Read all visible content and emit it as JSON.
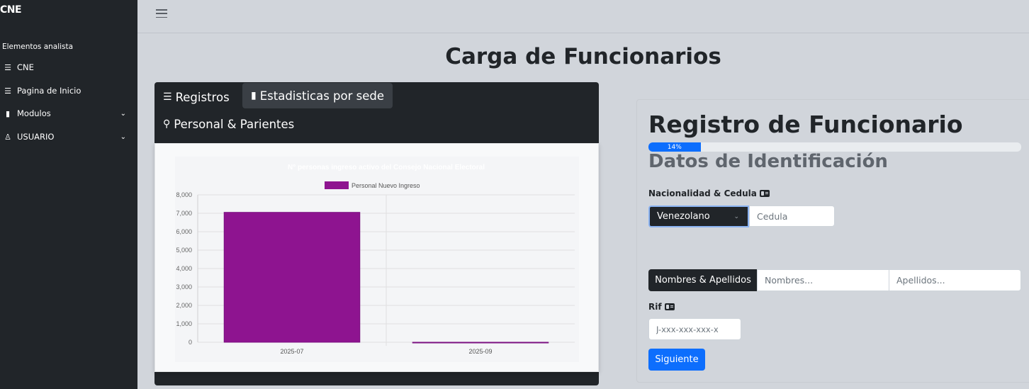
{
  "sidebar": {
    "brand": "CNE",
    "section_heading": "Elementos analista",
    "items": [
      {
        "label": "CNE",
        "icon": "list-icon"
      },
      {
        "label": "Pagina de Inicio",
        "icon": "list-icon"
      },
      {
        "label": "Modulos",
        "icon": "file-icon",
        "has_submenu": true
      },
      {
        "label": "USUARIO",
        "icon": "user-icon",
        "has_submenu": true
      }
    ]
  },
  "page": {
    "title": "Carga de Funcionarios"
  },
  "tabs": {
    "registros": "Registros",
    "estadisticas": "Estadisticas por sede",
    "personal": "Personal & Parientes"
  },
  "chart_data": {
    "type": "bar",
    "title": "N° personas ingreso activo del Consejo Nacional Electoral",
    "categories": [
      "2025-07",
      "2025-09"
    ],
    "series": [
      {
        "name": "Personal Nuevo Ingreso",
        "values": [
          7050,
          0
        ],
        "color": "#8e1490"
      }
    ],
    "ylim": [
      0,
      8000
    ],
    "yticks": [
      "8,000",
      "7,000",
      "6,000",
      "5,000",
      "4,000",
      "3,000",
      "2,000",
      "1,000",
      "0"
    ],
    "legend_position": "top-center",
    "grid": true
  },
  "form": {
    "title": "Registro de Funcionario",
    "progress_percent": 14,
    "progress_label": "14%",
    "section_title": "Datos de Identificación",
    "nacionalidad_label": "Nacionalidad & Cedula",
    "nacionalidad_value": "Venezolano",
    "cedula_placeholder": "Cedula",
    "nombres_group_label": "Nombres & Apellidos",
    "nombres_placeholder": "Nombres...",
    "apellidos_placeholder": "Apellidos...",
    "rif_label": "Rif",
    "rif_placeholder": "J-xxx-xxx-xxx-x",
    "next_button": "Siguiente"
  },
  "colors": {
    "sidebar_bg": "#212529",
    "accent": "#0d6efd",
    "bar": "#8e1490"
  }
}
